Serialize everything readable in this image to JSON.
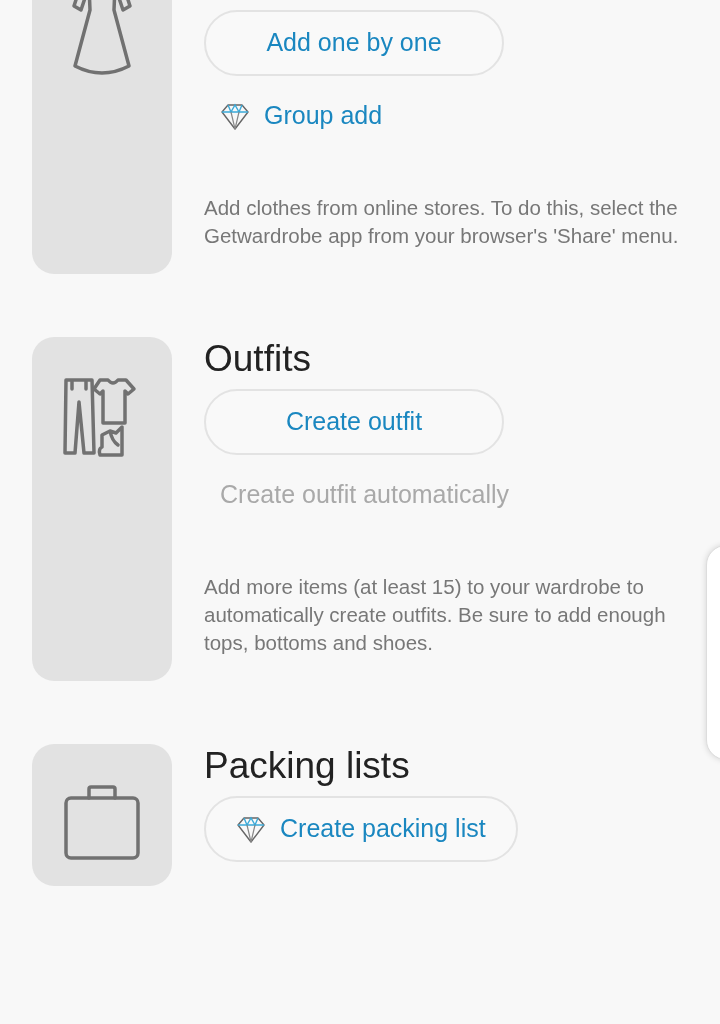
{
  "sections": [
    {
      "actions": [
        {
          "kind": "outlined",
          "label": "Add one by one",
          "premium": false
        },
        {
          "kind": "link",
          "label": "Group add",
          "premium": true,
          "disabled": false
        }
      ],
      "description": "Add clothes from online stores. To do this, select the Getwardrobe app from your browser's 'Share' menu."
    },
    {
      "title": "Outfits",
      "actions": [
        {
          "kind": "outlined",
          "label": "Create outfit",
          "premium": false
        },
        {
          "kind": "link",
          "label": "Create outfit automatically",
          "premium": false,
          "disabled": true
        }
      ],
      "description": "Add more items (at least 15) to your wardrobe to automatically create outfits. Be sure to add enough tops, bottoms and shoes."
    },
    {
      "title": "Packing lists",
      "actions": [
        {
          "kind": "outlined",
          "label": "Create packing list",
          "premium": true
        }
      ]
    }
  ]
}
